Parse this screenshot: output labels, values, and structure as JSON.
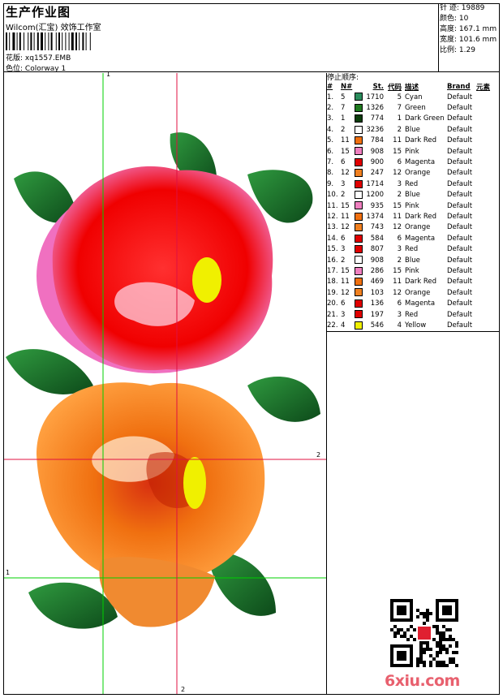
{
  "header": {
    "title": "生产作业图",
    "company": "Wilcom(汇宝) 效饰工作室",
    "pattern_label": "花版:",
    "pattern_value": "xq1557.EMB",
    "colorway_label": "色位:",
    "colorway_value": "Colorway 1"
  },
  "specs": [
    {
      "label": "针 迹:",
      "value": "19889"
    },
    {
      "label": "颜色:",
      "value": "10"
    },
    {
      "label": "高度:",
      "value": "167.1 mm"
    },
    {
      "label": "宽度:",
      "value": "101.6 mm"
    },
    {
      "label": "比例:",
      "value": "1.29"
    }
  ],
  "guides": {
    "top_left": "1",
    "right_mid": "2",
    "left_low": "1",
    "bottom_mid": "2"
  },
  "stop_sequence": {
    "title": "停止顺序:",
    "headers": [
      "#",
      "N#",
      "St.",
      "代码",
      "描述",
      "Brand",
      "元素"
    ],
    "rows": [
      {
        "n": "1.",
        "needle": "5",
        "color": "#2a8c5c",
        "st": "1710",
        "code": "5",
        "desc": "Cyan",
        "brand": "Default"
      },
      {
        "n": "2.",
        "needle": "7",
        "color": "#1f7a1f",
        "st": "1326",
        "code": "7",
        "desc": "Green",
        "brand": "Default"
      },
      {
        "n": "3.",
        "needle": "1",
        "color": "#0d3d0d",
        "st": "774",
        "code": "1",
        "desc": "Dark Green",
        "brand": "Default"
      },
      {
        "n": "4.",
        "needle": "2",
        "color": "#ffffff",
        "st": "3236",
        "code": "2",
        "desc": "Blue",
        "brand": "Default"
      },
      {
        "n": "5.",
        "needle": "11",
        "color": "#f07010",
        "st": "784",
        "code": "11",
        "desc": "Dark Red",
        "brand": "Default"
      },
      {
        "n": "6.",
        "needle": "15",
        "color": "#f080c0",
        "st": "908",
        "code": "15",
        "desc": "Pink",
        "brand": "Default"
      },
      {
        "n": "7.",
        "needle": "6",
        "color": "#e00000",
        "st": "900",
        "code": "6",
        "desc": "Magenta",
        "brand": "Default"
      },
      {
        "n": "8.",
        "needle": "12",
        "color": "#f08020",
        "st": "247",
        "code": "12",
        "desc": "Orange",
        "brand": "Default"
      },
      {
        "n": "9.",
        "needle": "3",
        "color": "#e00000",
        "st": "1714",
        "code": "3",
        "desc": "Red",
        "brand": "Default"
      },
      {
        "n": "10.",
        "needle": "2",
        "color": "#ffffff",
        "st": "1200",
        "code": "2",
        "desc": "Blue",
        "brand": "Default"
      },
      {
        "n": "11.",
        "needle": "15",
        "color": "#f080c0",
        "st": "935",
        "code": "15",
        "desc": "Pink",
        "brand": "Default"
      },
      {
        "n": "12.",
        "needle": "11",
        "color": "#f07010",
        "st": "1374",
        "code": "11",
        "desc": "Dark Red",
        "brand": "Default"
      },
      {
        "n": "13.",
        "needle": "12",
        "color": "#f08020",
        "st": "743",
        "code": "12",
        "desc": "Orange",
        "brand": "Default"
      },
      {
        "n": "14.",
        "needle": "6",
        "color": "#e00000",
        "st": "584",
        "code": "6",
        "desc": "Magenta",
        "brand": "Default"
      },
      {
        "n": "15.",
        "needle": "3",
        "color": "#e00000",
        "st": "807",
        "code": "3",
        "desc": "Red",
        "brand": "Default"
      },
      {
        "n": "16.",
        "needle": "2",
        "color": "#ffffff",
        "st": "908",
        "code": "2",
        "desc": "Blue",
        "brand": "Default"
      },
      {
        "n": "17.",
        "needle": "15",
        "color": "#f080c0",
        "st": "286",
        "code": "15",
        "desc": "Pink",
        "brand": "Default"
      },
      {
        "n": "18.",
        "needle": "11",
        "color": "#f07010",
        "st": "469",
        "code": "11",
        "desc": "Dark Red",
        "brand": "Default"
      },
      {
        "n": "19.",
        "needle": "12",
        "color": "#f08020",
        "st": "103",
        "code": "12",
        "desc": "Orange",
        "brand": "Default"
      },
      {
        "n": "20.",
        "needle": "6",
        "color": "#e00000",
        "st": "136",
        "code": "6",
        "desc": "Magenta",
        "brand": "Default"
      },
      {
        "n": "21.",
        "needle": "3",
        "color": "#e00000",
        "st": "197",
        "code": "3",
        "desc": "Red",
        "brand": "Default"
      },
      {
        "n": "22.",
        "needle": "4",
        "color": "#f0f000",
        "st": "546",
        "code": "4",
        "desc": "Yellow",
        "brand": "Default"
      }
    ]
  },
  "watermark": "6xiu.com",
  "qr_icon": "qr-code-icon"
}
